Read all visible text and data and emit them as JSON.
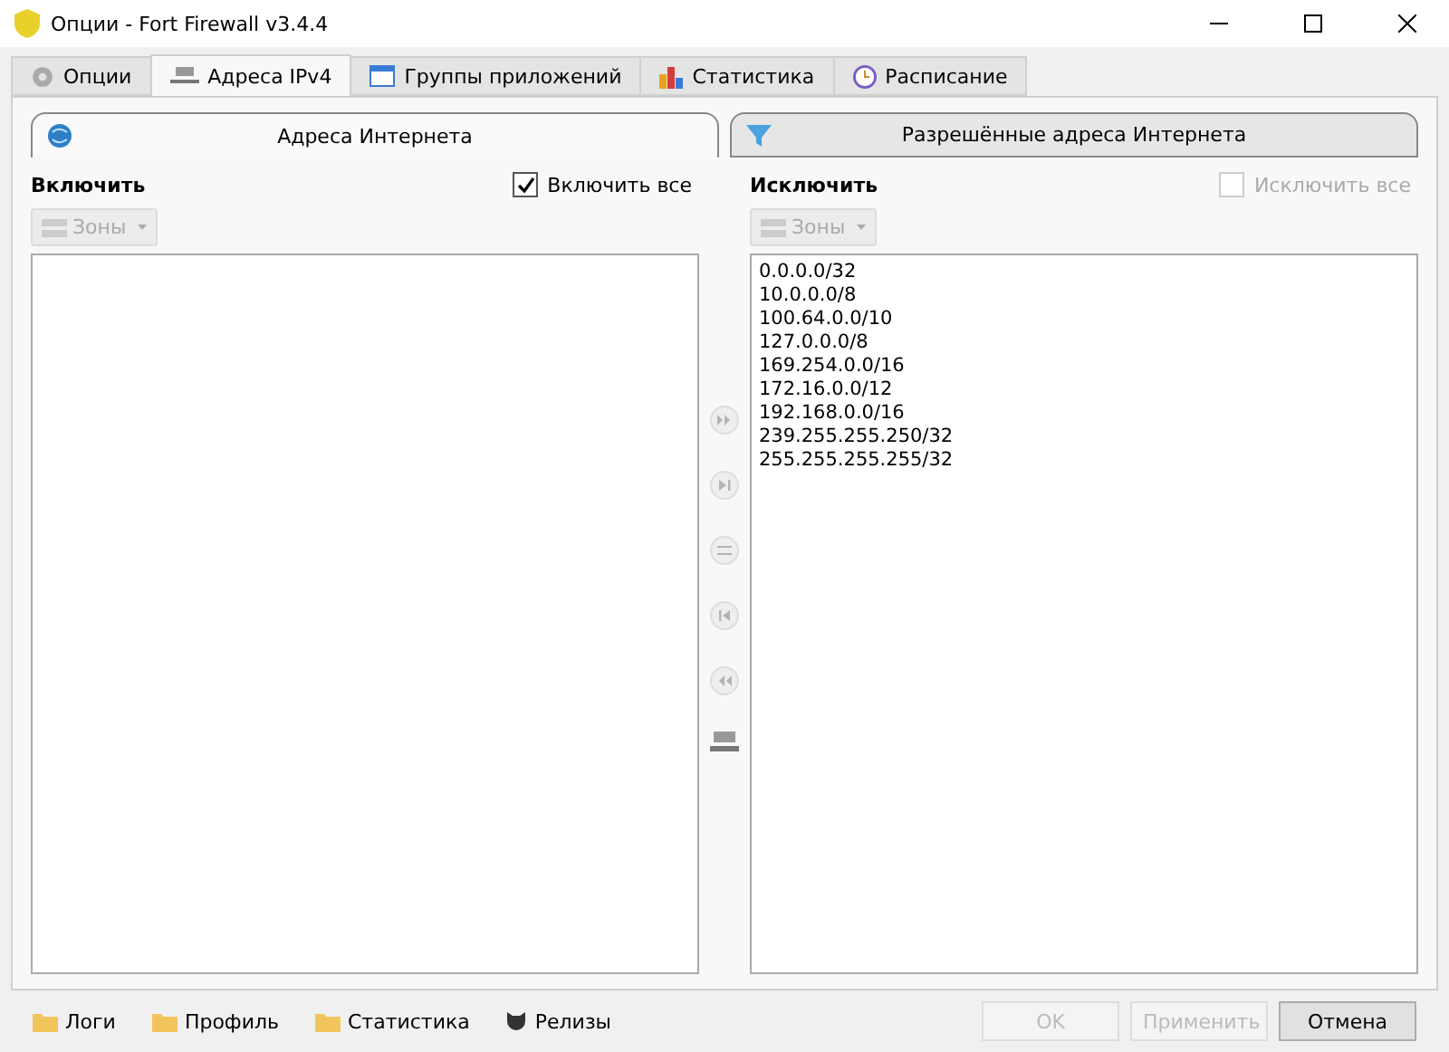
{
  "window": {
    "title": "Опции - Fort Firewall v3.4.4"
  },
  "tabs": [
    {
      "label": "Опции",
      "selected": false
    },
    {
      "label": "Адреса IPv4",
      "selected": true
    },
    {
      "label": "Группы приложений",
      "selected": false
    },
    {
      "label": "Статистика",
      "selected": false
    },
    {
      "label": "Расписание",
      "selected": false
    }
  ],
  "subtabs": [
    {
      "label": "Адреса Интернета",
      "selected": true
    },
    {
      "label": "Разрешённые адреса Интернета",
      "selected": false
    }
  ],
  "include": {
    "heading": "Включить",
    "all_label": "Включить все",
    "all_checked": true,
    "all_disabled": false,
    "zones_button": "Зоны",
    "zones_disabled": true
  },
  "exclude": {
    "heading": "Исключить",
    "all_label": "Исключить все",
    "all_checked": false,
    "all_disabled": true,
    "zones_button": "Зоны",
    "zones_disabled": true,
    "addresses": [
      "0.0.0.0/32",
      "10.0.0.0/8",
      "100.64.0.0/10",
      "127.0.0.0/8",
      "169.254.0.0/16",
      "172.16.0.0/12",
      "192.168.0.0/16",
      "239.255.255.250/32",
      "255.255.255.255/32"
    ]
  },
  "move_buttons": [
    {
      "kind": "all-right",
      "disabled": true
    },
    {
      "kind": "one-right",
      "disabled": true
    },
    {
      "kind": "swap",
      "disabled": true
    },
    {
      "kind": "one-left",
      "disabled": true
    },
    {
      "kind": "all-left",
      "disabled": true
    },
    {
      "kind": "network",
      "disabled": false
    }
  ],
  "footer_links": [
    {
      "label": "Логи"
    },
    {
      "label": "Профиль"
    },
    {
      "label": "Статистика"
    },
    {
      "label": "Релизы"
    }
  ],
  "buttons": [
    {
      "label": "OK",
      "disabled": true
    },
    {
      "label": "Применить",
      "disabled": true
    },
    {
      "label": "Отмена",
      "disabled": false
    }
  ]
}
